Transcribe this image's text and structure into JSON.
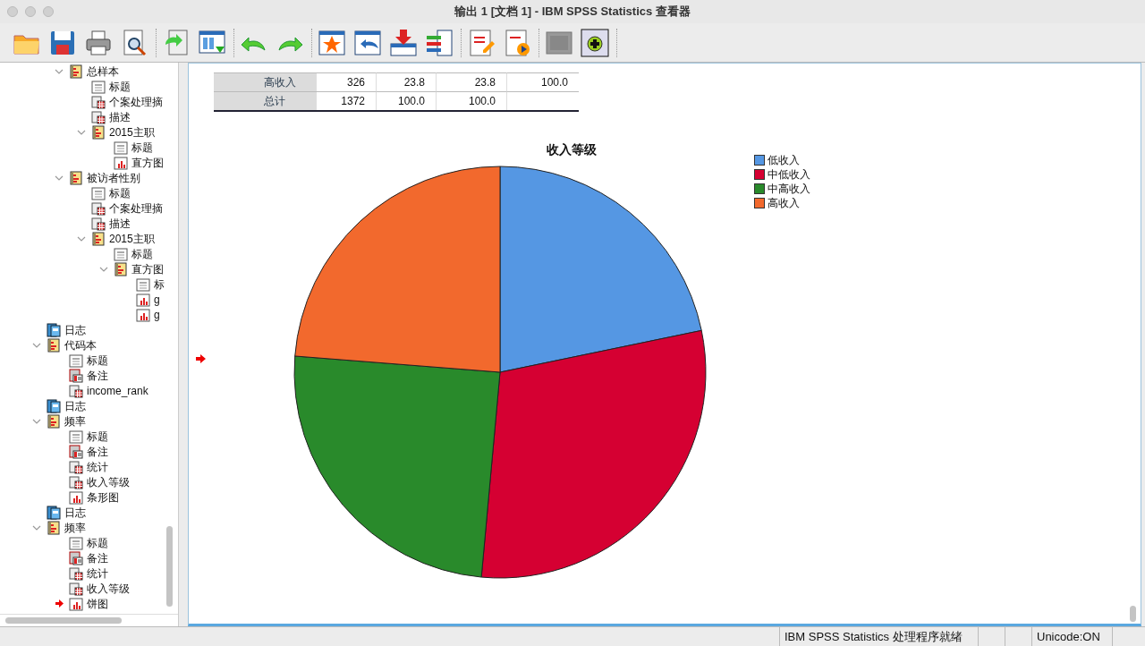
{
  "window": {
    "title": "输出 1 [文档 1] - IBM SPSS Statistics 查看器"
  },
  "tree": {
    "continued": [
      {
        "label": "总样本",
        "kind": "section",
        "expanded": true,
        "children": [
          {
            "label": "标题",
            "kind": "heading"
          },
          {
            "label": "个案处理摘",
            "kind": "table"
          },
          {
            "label": "描述",
            "kind": "table"
          },
          {
            "label": "2015主职",
            "kind": "section",
            "expanded": true,
            "children": [
              {
                "label": "标题",
                "kind": "heading"
              },
              {
                "label": "直方图",
                "kind": "chart"
              }
            ]
          }
        ]
      },
      {
        "label": "被访者性别",
        "kind": "section",
        "expanded": true,
        "children": [
          {
            "label": "标题",
            "kind": "heading"
          },
          {
            "label": "个案处理摘",
            "kind": "table"
          },
          {
            "label": "描述",
            "kind": "table"
          },
          {
            "label": "2015主职",
            "kind": "section",
            "expanded": true,
            "children": [
              {
                "label": "标题",
                "kind": "heading"
              },
              {
                "label": "直方图",
                "kind": "section",
                "expanded": true,
                "children": [
                  {
                    "label": "标",
                    "kind": "heading"
                  },
                  {
                    "label": "g",
                    "kind": "chart"
                  },
                  {
                    "label": "g",
                    "kind": "chart"
                  }
                ]
              }
            ]
          }
        ]
      }
    ],
    "items": [
      {
        "label": "日志",
        "kind": "log"
      },
      {
        "label": "代码本",
        "kind": "section",
        "expanded": true,
        "children": [
          {
            "label": "标题",
            "kind": "heading"
          },
          {
            "label": "备注",
            "kind": "note"
          },
          {
            "label": "income_rank",
            "kind": "table"
          }
        ]
      },
      {
        "label": "日志",
        "kind": "log"
      },
      {
        "label": "频率",
        "kind": "section",
        "expanded": true,
        "children": [
          {
            "label": "标题",
            "kind": "heading"
          },
          {
            "label": "备注",
            "kind": "note"
          },
          {
            "label": "统计",
            "kind": "table"
          },
          {
            "label": "收入等级",
            "kind": "table"
          },
          {
            "label": "条形图",
            "kind": "chart"
          }
        ]
      },
      {
        "label": "日志",
        "kind": "log"
      },
      {
        "label": "频率",
        "kind": "section",
        "expanded": true,
        "children": [
          {
            "label": "标题",
            "kind": "heading"
          },
          {
            "label": "备注",
            "kind": "note"
          },
          {
            "label": "统计",
            "kind": "table"
          },
          {
            "label": "收入等级",
            "kind": "table"
          },
          {
            "label": "饼图",
            "kind": "chart",
            "current": true
          }
        ]
      }
    ]
  },
  "table": {
    "rows": [
      {
        "label": "高收入",
        "cells": [
          "326",
          "23.8",
          "23.8",
          "100.0"
        ]
      },
      {
        "label": "总计",
        "cells": [
          "1372",
          "100.0",
          "100.0",
          null
        ]
      }
    ]
  },
  "chart": {
    "title": "收入等级",
    "legend": [
      {
        "label": "低收入",
        "color": "#5597e3"
      },
      {
        "label": "中低收入",
        "color": "#d50032"
      },
      {
        "label": "中高收入",
        "color": "#298a2b"
      },
      {
        "label": "高收入",
        "color": "#f2692d"
      }
    ]
  },
  "status_bar": {
    "message": "IBM SPSS Statistics 处理程序就绪",
    "encoding": "Unicode:ON"
  }
}
